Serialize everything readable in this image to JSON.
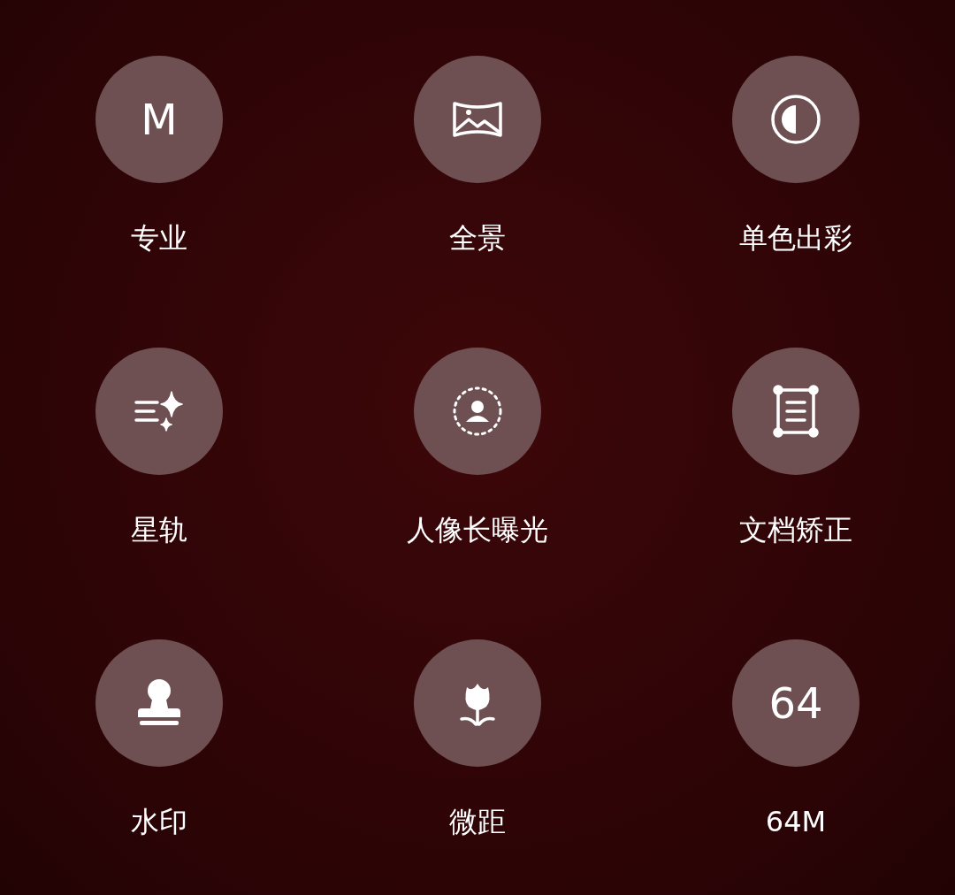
{
  "modes": [
    {
      "label": "专业",
      "kind": "glyph",
      "glyph": "M"
    },
    {
      "label": "全景",
      "kind": "icon"
    },
    {
      "label": "单色出彩",
      "kind": "icon"
    },
    {
      "label": "星轨",
      "kind": "icon"
    },
    {
      "label": "人像长曝光",
      "kind": "icon"
    },
    {
      "label": "文档矫正",
      "kind": "icon"
    },
    {
      "label": "水印",
      "kind": "icon"
    },
    {
      "label": "微距",
      "kind": "icon"
    },
    {
      "label": "64M",
      "kind": "glyph",
      "glyph": "64"
    }
  ]
}
